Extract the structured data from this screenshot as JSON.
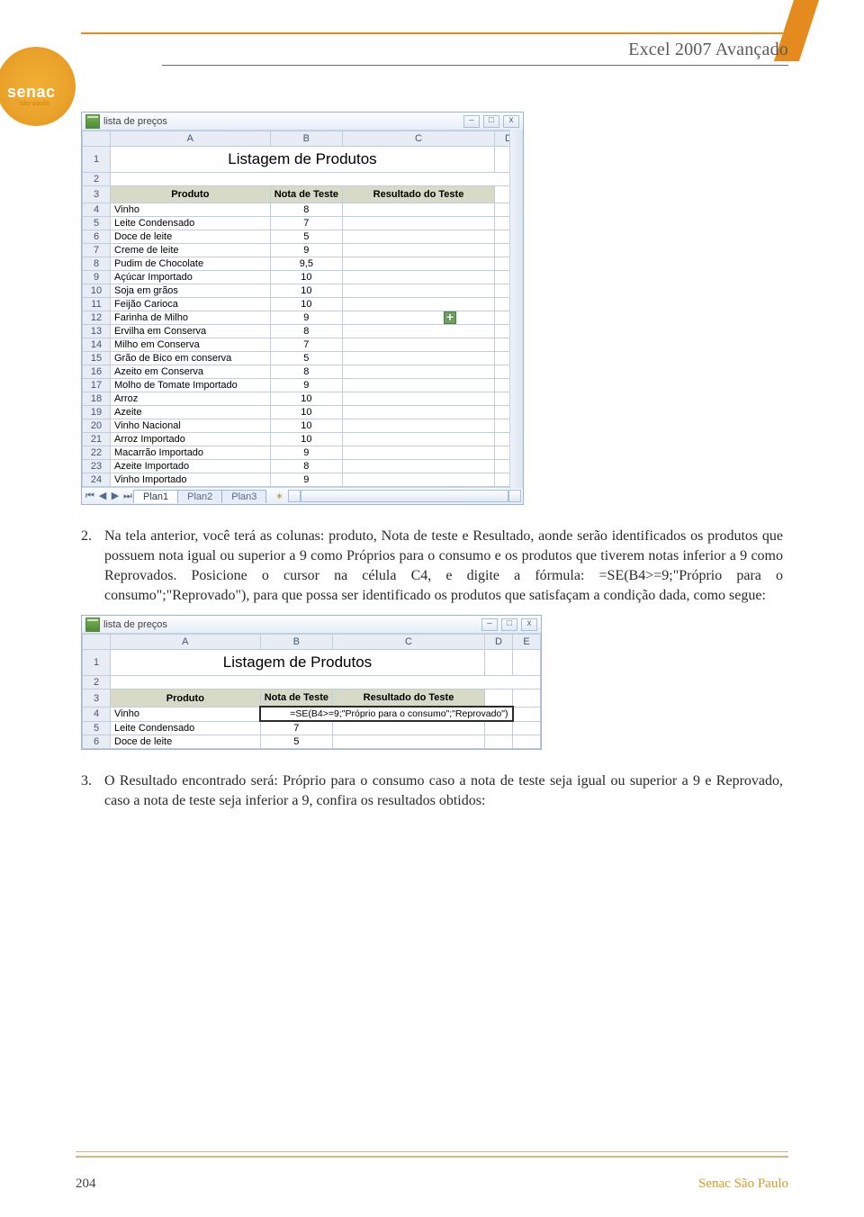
{
  "header": {
    "title": "Excel 2007 Avançado",
    "logo_text": "senac",
    "logo_subtext": "são paulo"
  },
  "excel1": {
    "workbook_title": "lista de preços",
    "columns": [
      "A",
      "B",
      "C",
      "D"
    ],
    "big_title": "Listagem de Produtos",
    "header_row": [
      "Produto",
      "Nota de Teste",
      "Resultado do Teste"
    ],
    "rows": [
      {
        "n": "4",
        "a": "Vinho",
        "b": "8"
      },
      {
        "n": "5",
        "a": "Leite Condensado",
        "b": "7"
      },
      {
        "n": "6",
        "a": "Doce de leite",
        "b": "5"
      },
      {
        "n": "7",
        "a": "Creme de leite",
        "b": "9"
      },
      {
        "n": "8",
        "a": "Pudim de Chocolate",
        "b": "9,5"
      },
      {
        "n": "9",
        "a": "Açúcar Importado",
        "b": "10"
      },
      {
        "n": "10",
        "a": "Soja em grãos",
        "b": "10"
      },
      {
        "n": "11",
        "a": "Feijão Carioca",
        "b": "10"
      },
      {
        "n": "12",
        "a": "Farinha de Milho",
        "b": "9"
      },
      {
        "n": "13",
        "a": "Ervilha em Conserva",
        "b": "8"
      },
      {
        "n": "14",
        "a": "Milho em Conserva",
        "b": "7"
      },
      {
        "n": "15",
        "a": "Grão de Bico em conserva",
        "b": "5"
      },
      {
        "n": "16",
        "a": "Azeito em Conserva",
        "b": "8"
      },
      {
        "n": "17",
        "a": "Molho de Tomate Importado",
        "b": "9"
      },
      {
        "n": "18",
        "a": "Arroz",
        "b": "10"
      },
      {
        "n": "19",
        "a": "Azeite",
        "b": "10"
      },
      {
        "n": "20",
        "a": "Vinho Nacional",
        "b": "10"
      },
      {
        "n": "21",
        "a": "Arroz Importado",
        "b": "10"
      },
      {
        "n": "22",
        "a": "Macarrão Importado",
        "b": "9"
      },
      {
        "n": "23",
        "a": "Azeite Importado",
        "b": "8"
      },
      {
        "n": "24",
        "a": "Vinho Importado",
        "b": "9"
      }
    ],
    "tabs": [
      "Plan1",
      "Plan2",
      "Plan3"
    ]
  },
  "paragraph2": {
    "num": "2.",
    "text": "Na tela anterior, você terá as colunas: produto, Nota de teste e Resultado, aonde serão identificados os produtos que possuem nota igual ou superior a 9 como Próprios para o consumo e os produtos que tiverem notas inferior a 9 como Reprovados. Posicione o cursor na célula C4, e digite a fórmula: =SE(B4>=9;\"Próprio para o consumo\";\"Reprovado\"), para que possa ser identificado os produtos que satisfaçam a condição dada, como segue:"
  },
  "excel2": {
    "workbook_title": "lista de preços",
    "columns": [
      "A",
      "B",
      "C",
      "D",
      "E"
    ],
    "big_title": "Listagem de Produtos",
    "header_row": [
      "Produto",
      "Nota de Teste",
      "Resultado do Teste"
    ],
    "formula": "=SE(B4>=9;\"Próprio para o consumo\";\"Reprovado\")",
    "rows": [
      {
        "n": "4",
        "a": "Vinho"
      },
      {
        "n": "5",
        "a": "Leite Condensado",
        "b": "7"
      },
      {
        "n": "6",
        "a": "Doce de leite",
        "b": "5"
      }
    ]
  },
  "paragraph3": {
    "num": "3.",
    "text": "O Resultado encontrado será: Próprio para o consumo caso a nota de teste seja igual ou superior a 9 e Reprovado, caso a nota de teste seja inferior a 9, confira os resultados obtidos:"
  },
  "footer": {
    "page": "204",
    "brand": "Senac São Paulo"
  }
}
